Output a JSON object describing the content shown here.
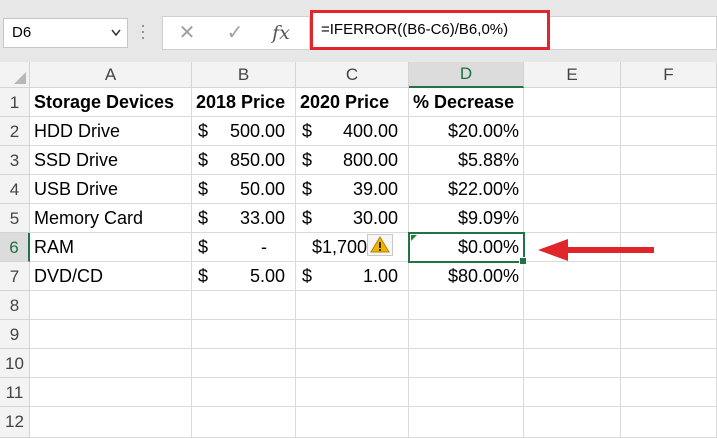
{
  "name_box": {
    "value": "D6"
  },
  "formula_bar": {
    "cancel_glyph": "✕",
    "enter_glyph": "✓",
    "fx_glyph": "fx",
    "formula": "=IFERROR((B6-C6)/B6,0%)"
  },
  "columns": [
    "A",
    "B",
    "C",
    "D",
    "E",
    "F"
  ],
  "rows": [
    "1",
    "2",
    "3",
    "4",
    "5",
    "6",
    "7",
    "8",
    "9",
    "10",
    "11",
    "12"
  ],
  "headers": {
    "a": "Storage Devices",
    "b": "2018 Price",
    "c": "2020 Price",
    "d": "% Decrease"
  },
  "currency_symbol": "$",
  "table": [
    {
      "device": "HDD Drive",
      "price_2018": "500.00",
      "price_2020": "400.00",
      "decrease": "$20.00%"
    },
    {
      "device": "SSD Drive",
      "price_2018": "850.00",
      "price_2020": "800.00",
      "decrease": "$5.88%"
    },
    {
      "device": "USB Drive",
      "price_2018": "50.00",
      "price_2020": "39.00",
      "decrease": "$22.00%"
    },
    {
      "device": "Memory Card",
      "price_2018": "33.00",
      "price_2020": "30.00",
      "decrease": "$9.09%"
    },
    {
      "device": "RAM",
      "price_2018": "-",
      "price_2020_text": "$1,700.00",
      "decrease": "$0.00%"
    },
    {
      "device": "DVD/CD",
      "price_2018": "5.00",
      "price_2020": "1.00",
      "decrease": "$80.00%"
    }
  ],
  "selected_cell": "D6",
  "colors": {
    "highlight_red": "#e0252b",
    "selection_green": "#217346",
    "warning_yellow": "#f0b400"
  },
  "icons": {
    "warning": "error-warning-icon",
    "arrow": "red-left-arrow"
  }
}
